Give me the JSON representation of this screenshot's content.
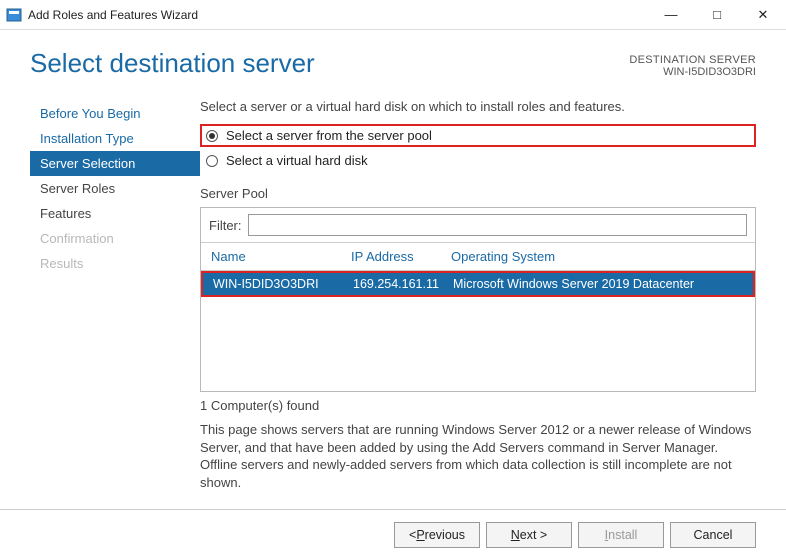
{
  "window": {
    "title": "Add Roles and Features Wizard"
  },
  "header": {
    "title": "Select destination server",
    "dest_label": "DESTINATION SERVER",
    "dest_value": "WIN-I5DID3O3DRI"
  },
  "nav": {
    "items": [
      {
        "label": "Before You Begin",
        "state": "link"
      },
      {
        "label": "Installation Type",
        "state": "link"
      },
      {
        "label": "Server Selection",
        "state": "selected"
      },
      {
        "label": "Server Roles",
        "state": "normal"
      },
      {
        "label": "Features",
        "state": "normal"
      },
      {
        "label": "Confirmation",
        "state": "disabled"
      },
      {
        "label": "Results",
        "state": "disabled"
      }
    ]
  },
  "main": {
    "intro": "Select a server or a virtual hard disk on which to install roles and features.",
    "radio1": "Select a server from the server pool",
    "radio2": "Select a virtual hard disk",
    "pool_label": "Server Pool",
    "filter_label": "Filter:",
    "filter_value": "",
    "columns": {
      "name": "Name",
      "ip": "IP Address",
      "os": "Operating System"
    },
    "rows": [
      {
        "name": "WIN-I5DID3O3DRI",
        "ip": "169.254.161.11",
        "os": "Microsoft Windows Server 2019 Datacenter"
      }
    ],
    "found": "1 Computer(s) found",
    "desc": "This page shows servers that are running Windows Server 2012 or a newer release of Windows Server, and that have been added by using the Add Servers command in Server Manager. Offline servers and newly-added servers from which data collection is still incomplete are not shown."
  },
  "footer": {
    "previous_letter": "P",
    "previous_rest": "revious",
    "next_letter": "N",
    "next_rest": "ext >",
    "install_letter": "I",
    "install_rest": "nstall",
    "cancel": "Cancel",
    "prev_prefix": "< "
  }
}
